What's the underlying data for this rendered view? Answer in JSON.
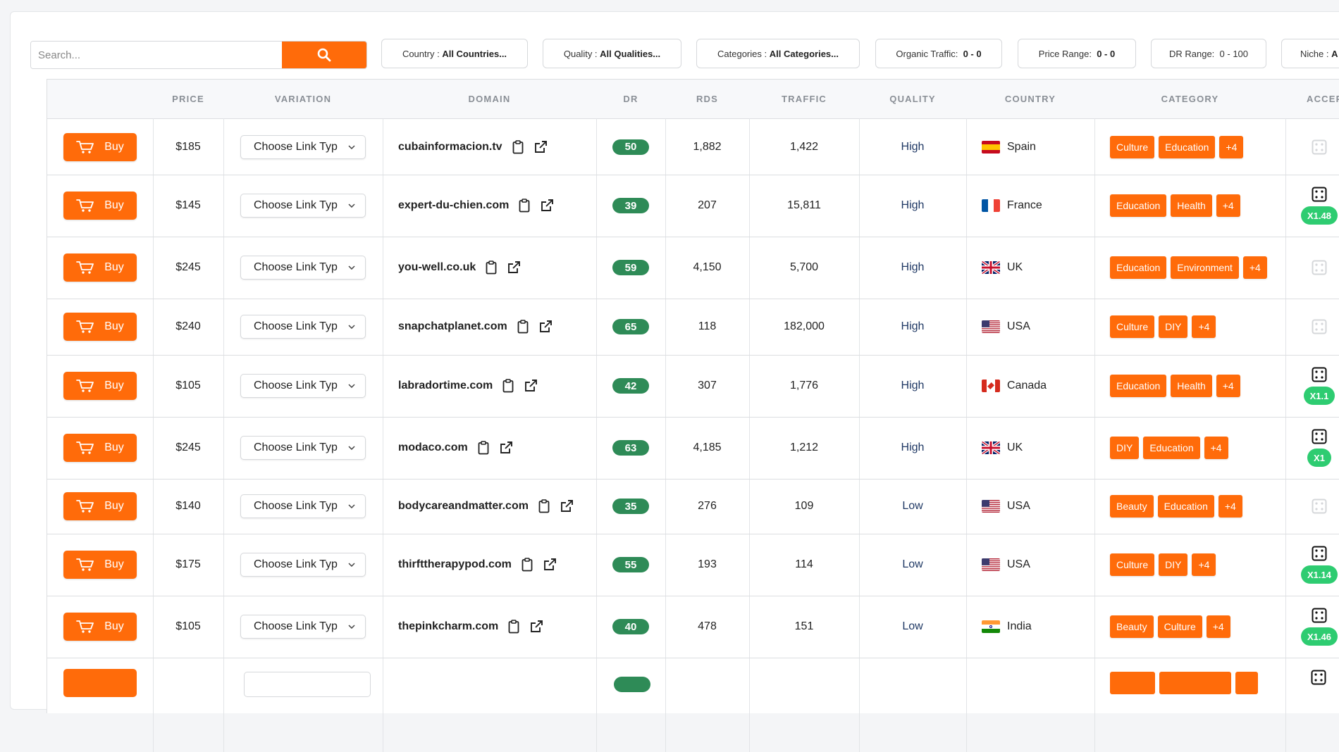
{
  "filters": {
    "search_placeholder": "Search...",
    "country": {
      "label": "Country :",
      "value": "All Countries..."
    },
    "quality": {
      "label": "Quality :",
      "value": "All Qualities..."
    },
    "categories": {
      "label": "Categories :",
      "value": "All Categories..."
    },
    "organic": {
      "label": "Organic Traffic:",
      "value": "0 - 0"
    },
    "price": {
      "label": "Price Range:",
      "value": "0 - 0"
    },
    "dr": {
      "label": "DR Range:",
      "value": "0 - 100"
    },
    "niche": {
      "label": "Niche :",
      "value": "A"
    }
  },
  "columns": {
    "price": "PRICE",
    "variation": "VARIATION",
    "domain": "DOMAIN",
    "dr": "DR",
    "rds": "RDS",
    "traffic": "TRAFFIC",
    "quality": "QUALITY",
    "country": "COUNTRY",
    "category": "CATEGORY",
    "accepted": "ACCEP"
  },
  "buy_label": "Buy",
  "variation_placeholder": "Choose Link Typ",
  "rows": [
    {
      "price": "$185",
      "domain": "cubainformacion.tv",
      "dr": "50",
      "rds": "1,882",
      "traffic": "1,422",
      "quality": "High",
      "country": "Spain",
      "flag": "es",
      "categories": [
        "Culture",
        "Education",
        "+4"
      ],
      "multiplier": null
    },
    {
      "price": "$145",
      "domain": "expert-du-chien.com",
      "dr": "39",
      "rds": "207",
      "traffic": "15,811",
      "quality": "High",
      "country": "France",
      "flag": "fr",
      "categories": [
        "Education",
        "Health",
        "+4"
      ],
      "multiplier": "X1.48"
    },
    {
      "price": "$245",
      "domain": "you-well.co.uk",
      "dr": "59",
      "rds": "4,150",
      "traffic": "5,700",
      "quality": "High",
      "country": "UK",
      "flag": "uk",
      "categories": [
        "Education",
        "Environment",
        "+4"
      ],
      "multiplier": null
    },
    {
      "price": "$240",
      "domain": "snapchatplanet.com",
      "dr": "65",
      "rds": "118",
      "traffic": "182,000",
      "quality": "High",
      "country": "USA",
      "flag": "us",
      "categories": [
        "Culture",
        "DIY",
        "+4"
      ],
      "multiplier": null
    },
    {
      "price": "$105",
      "domain": "labradortime.com",
      "dr": "42",
      "rds": "307",
      "traffic": "1,776",
      "quality": "High",
      "country": "Canada",
      "flag": "ca",
      "categories": [
        "Education",
        "Health",
        "+4"
      ],
      "multiplier": "X1.1"
    },
    {
      "price": "$245",
      "domain": "modaco.com",
      "dr": "63",
      "rds": "4,185",
      "traffic": "1,212",
      "quality": "High",
      "country": "UK",
      "flag": "uk",
      "categories": [
        "DIY",
        "Education",
        "+4"
      ],
      "multiplier": "X1"
    },
    {
      "price": "$140",
      "domain": "bodycareandmatter.com",
      "dr": "35",
      "rds": "276",
      "traffic": "109",
      "quality": "Low",
      "country": "USA",
      "flag": "us",
      "categories": [
        "Beauty",
        "Education",
        "+4"
      ],
      "multiplier": null
    },
    {
      "price": "$175",
      "domain": "thirfttherapypod.com",
      "dr": "55",
      "rds": "193",
      "traffic": "114",
      "quality": "Low",
      "country": "USA",
      "flag": "us",
      "categories": [
        "Culture",
        "DIY",
        "+4"
      ],
      "multiplier": "X1.14"
    },
    {
      "price": "$105",
      "domain": "thepinkcharm.com",
      "dr": "40",
      "rds": "478",
      "traffic": "151",
      "quality": "Low",
      "country": "India",
      "flag": "in",
      "categories": [
        "Beauty",
        "Culture",
        "+4"
      ],
      "multiplier": "X1.46"
    }
  ],
  "colors": {
    "accent": "#ff6b0a",
    "dr_badge": "#2e8b57",
    "multiplier": "#2ecc71"
  }
}
